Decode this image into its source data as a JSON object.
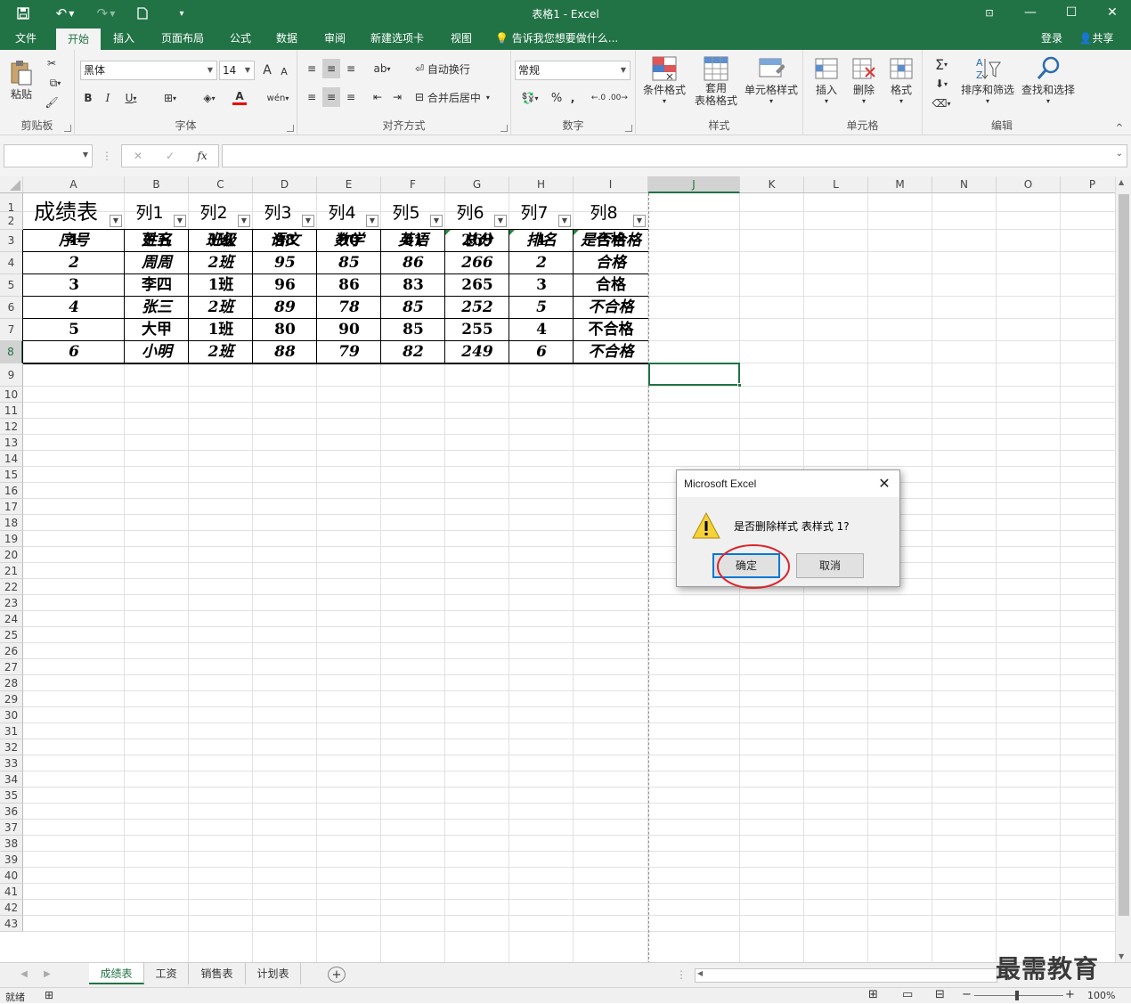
{
  "app": {
    "window_title": "表格1 - Excel"
  },
  "ribbon_tabs": [
    "文件",
    "开始",
    "插入",
    "页面布局",
    "公式",
    "数据",
    "审阅",
    "新建选项卡",
    "视图"
  ],
  "tell_me": "告诉我您想要做什么...",
  "account": {
    "signin": "登录",
    "share": "共享"
  },
  "ribbon": {
    "clipboard": {
      "paste": "粘贴",
      "label": "剪贴板"
    },
    "font": {
      "name": "黑体",
      "size": "14",
      "label": "字体",
      "bold": "B",
      "italic": "I",
      "underline": "U",
      "grow": "A",
      "shrink": "A"
    },
    "alignment": {
      "wrap": "自动换行",
      "merge": "合并后居中",
      "label": "对齐方式"
    },
    "number": {
      "format": "常规",
      "label": "数字",
      "percent": "%",
      "comma": ","
    },
    "styles": {
      "conditional": "条件格式",
      "table_fmt": "套用\n表格格式",
      "cell_styles": "单元格样式",
      "label": "样式"
    },
    "cells": {
      "insert": "插入",
      "delete": "删除",
      "format": "格式",
      "label": "单元格"
    },
    "editing": {
      "sort": "排序和筛选",
      "find": "查找和选择",
      "label": "编辑"
    }
  },
  "formula_bar": {
    "cancel": "✕",
    "enter": "✓",
    "fx": "fx",
    "value": ""
  },
  "columns": [
    "A",
    "B",
    "C",
    "D",
    "E",
    "F",
    "G",
    "H",
    "I",
    "J",
    "K",
    "L",
    "M",
    "N",
    "O",
    "P"
  ],
  "selected_column": "J",
  "sheet": {
    "header_row": [
      "成绩表",
      "列1",
      "列2",
      "列3",
      "列4",
      "列5",
      "列6",
      "列7",
      "列8"
    ],
    "title_row": [
      "序号",
      "姓名",
      "班级",
      "语文",
      "数学",
      "英语",
      "总分",
      "排名",
      "是否合格"
    ],
    "rows": [
      [
        "1",
        "王五",
        "1班",
        "98",
        "90",
        "81",
        "269",
        "1",
        "合格"
      ],
      [
        "2",
        "周周",
        "2班",
        "95",
        "85",
        "86",
        "266",
        "2",
        "合格"
      ],
      [
        "3",
        "李四",
        "1班",
        "96",
        "86",
        "83",
        "265",
        "3",
        "合格"
      ],
      [
        "4",
        "张三",
        "2班",
        "89",
        "78",
        "85",
        "252",
        "5",
        "不合格"
      ],
      [
        "5",
        "大甲",
        "1班",
        "80",
        "90",
        "85",
        "255",
        "4",
        "不合格"
      ],
      [
        "6",
        "小明",
        "2班",
        "88",
        "79",
        "82",
        "249",
        "6",
        "不合格"
      ]
    ]
  },
  "row_numbers": [
    "1",
    "2",
    "3",
    "4",
    "5",
    "6",
    "7",
    "8",
    "9",
    "10",
    "11",
    "12",
    "13",
    "14",
    "15",
    "16",
    "17",
    "18",
    "19",
    "20",
    "21",
    "22",
    "23",
    "24",
    "25",
    "26",
    "27",
    "28",
    "29",
    "30",
    "31",
    "32",
    "33",
    "34",
    "35",
    "36",
    "37",
    "38",
    "39",
    "40",
    "41",
    "42",
    "43"
  ],
  "sheet_tabs": [
    "成绩表",
    "工资",
    "销售表",
    "计划表"
  ],
  "active_sheet": "成绩表",
  "status": {
    "ready": "就绪",
    "zoom": "100%"
  },
  "dialog": {
    "title": "Microsoft Excel",
    "message": "是否删除样式 表样式 1?",
    "ok": "确定",
    "cancel": "取消"
  },
  "watermark": "最需教育",
  "colors": {
    "excel_green": "#217346",
    "highlight_circle": "#d9262b",
    "dialog_focus": "#0078d7"
  }
}
